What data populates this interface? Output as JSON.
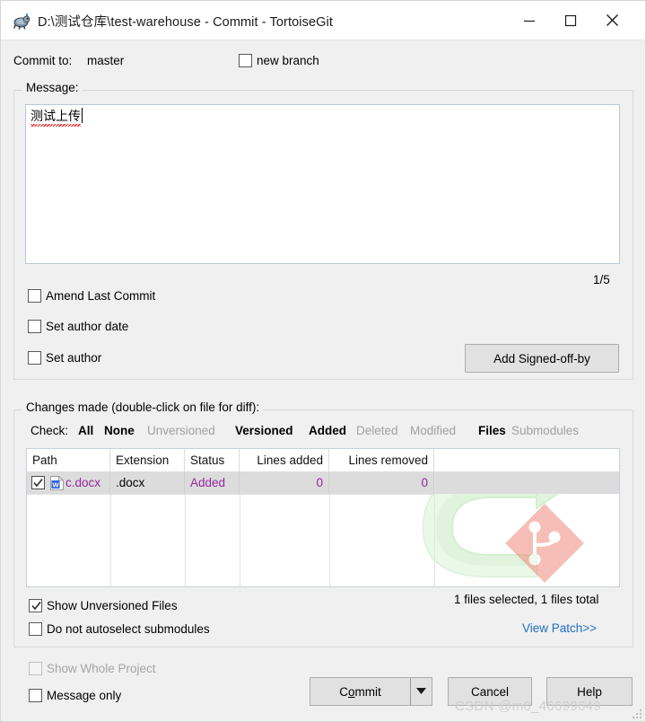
{
  "window": {
    "title": "D:\\测试仓库\\test-warehouse - Commit - TortoiseGit",
    "icon": "tortoisegit-icon",
    "minimize": "–",
    "maximize": "☐",
    "close": "✕"
  },
  "commit_to": {
    "label": "Commit to:",
    "branch": "master",
    "new_branch_label": "new branch",
    "new_branch_checked": false
  },
  "message": {
    "legend": "Message:",
    "value": "测试上传",
    "counter": "1/5",
    "spellcheck": true
  },
  "options": {
    "amend_last_commit": {
      "label": "Amend Last Commit",
      "checked": false
    },
    "set_author_date": {
      "label": "Set author date",
      "checked": false
    },
    "set_author": {
      "label": "Set author",
      "checked": false
    },
    "add_signed_off_by": "Add Signed-off-by"
  },
  "changes": {
    "legend": "Changes made (double-click on file for diff):",
    "check_label": "Check:",
    "filters": [
      {
        "label": "All",
        "state": "enabled"
      },
      {
        "label": "None",
        "state": "enabled"
      },
      {
        "label": "Unversioned",
        "state": "disabled"
      },
      {
        "label": "Versioned",
        "state": "enabled"
      },
      {
        "label": "Added",
        "state": "enabled"
      },
      {
        "label": "Deleted",
        "state": "disabled"
      },
      {
        "label": "Modified",
        "state": "disabled"
      },
      {
        "label": "Files",
        "state": "enabled"
      },
      {
        "label": "Submodules",
        "state": "disabled"
      }
    ],
    "columns": [
      "Path",
      "Extension",
      "Status",
      "Lines added",
      "Lines removed"
    ],
    "rows": [
      {
        "checked": true,
        "icon": "word-document-icon",
        "path": "c.docx",
        "extension": ".docx",
        "status": "Added",
        "lines_added": "0",
        "lines_removed": "0"
      }
    ],
    "status_color": "#93269b",
    "summary": "1 files selected, 1 files total",
    "view_patch": "View Patch>>",
    "show_unversioned_files": {
      "label": "Show Unversioned Files",
      "checked": true
    },
    "do_not_autoselect_submodules": {
      "label": "Do not autoselect submodules",
      "checked": false
    }
  },
  "footer": {
    "show_whole_project": {
      "label": "Show Whole Project",
      "checked": false,
      "state": "disabled"
    },
    "message_only": {
      "label": "Message only",
      "checked": false
    },
    "commit_button": "Commit",
    "commit_accel": "o",
    "cancel_button": "Cancel",
    "help_button": "Help",
    "watermark": "CSDN @m0_46699649"
  },
  "colors": {
    "dialog_bg": "#f0f0f0",
    "added_text": "#93269b",
    "link": "#1f6fc4",
    "logo_green": "#b9e6b5",
    "logo_red": "#ef8679"
  }
}
